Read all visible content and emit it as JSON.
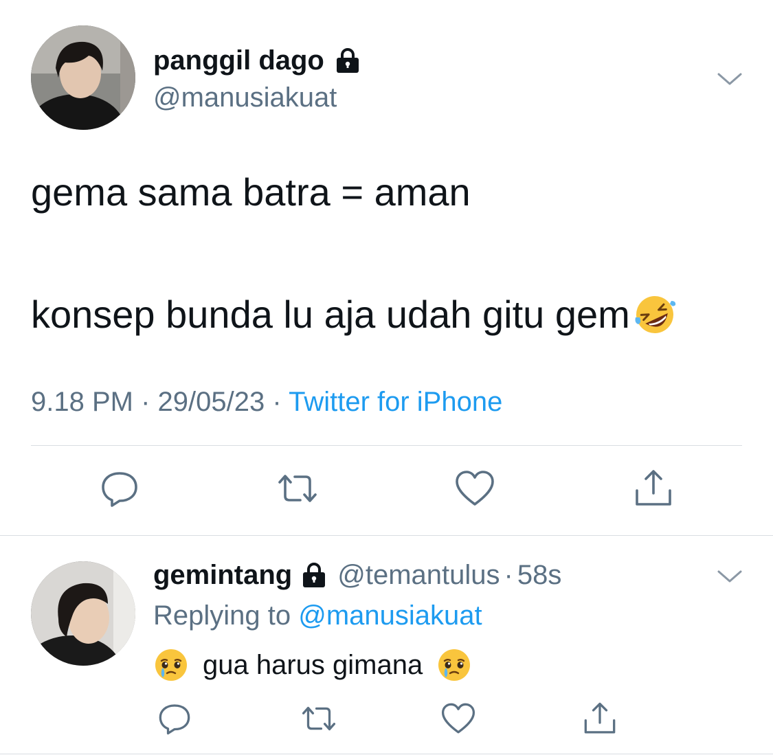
{
  "tweet": {
    "author": {
      "display_name": "panggil dago",
      "handle": "@manusiakuat",
      "protected": true
    },
    "text_line_1": "gema sama batra = aman",
    "text_line_2": "konsep bunda lu aja udah gitu gem",
    "text_line_2_emoji": "rolling-on-floor-laughing-emoji",
    "time": "9.18 PM",
    "date": "29/05/23",
    "separator": "·",
    "source": "Twitter for iPhone"
  },
  "reply": {
    "author": {
      "display_name": "gemintang",
      "handle": "@temantulus",
      "protected": true
    },
    "separator": "·",
    "age": "58s",
    "replying_prefix": "Replying to",
    "replying_to": "@manusiakuat",
    "text": "gua harus gimana",
    "emoji": "face-holding-back-tears-emoji"
  },
  "icons": {
    "reply": "reply-icon",
    "retweet": "retweet-icon",
    "like": "heart-icon",
    "share": "share-icon",
    "caret": "chevron-down-icon",
    "lock": "lock-icon"
  },
  "colors": {
    "text": "#0f1419",
    "secondary": "#5b7083",
    "link": "#1d9bf0",
    "divider": "#d9dde1"
  }
}
